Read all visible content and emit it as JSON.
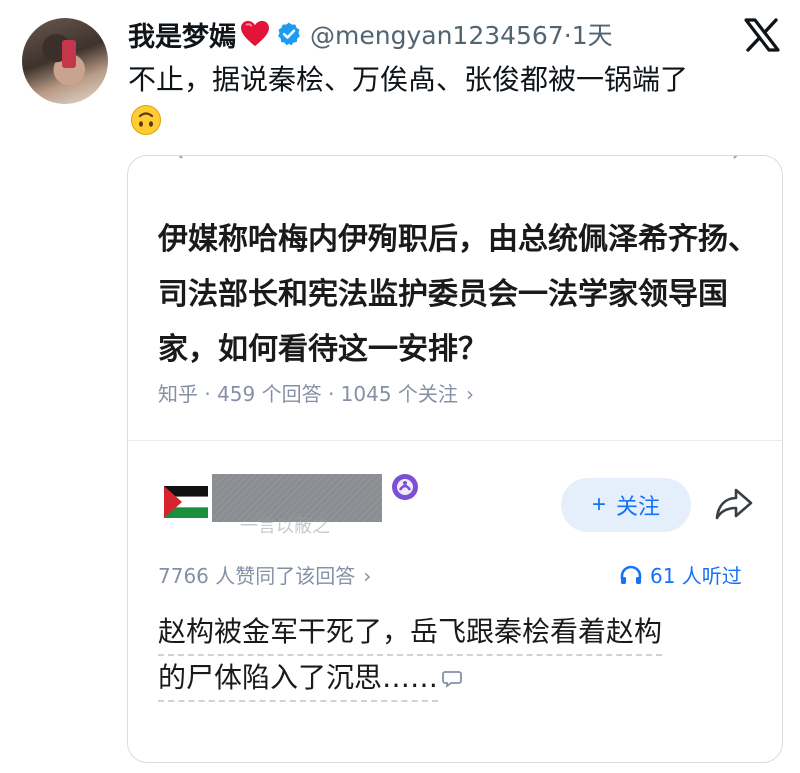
{
  "tweet": {
    "display_name": "我是梦嫣",
    "handle_time": "@mengyan1234567·1天",
    "text": "不止，据说秦桧、万俟卨、张俊都被一锅端了"
  },
  "icons": {
    "heart": "red-heart-icon",
    "verified": "verified-badge-icon",
    "platform": "x-logo-icon",
    "emoji": "upside-down-face-icon",
    "flag": "palestine-flag-icon",
    "share": "share-arrow-icon",
    "headphones": "headphones-icon",
    "comment": "comment-bubble-icon"
  },
  "colors": {
    "accent_blue": "#1772f6",
    "follow_bg": "#e5eefb",
    "meta_gray": "#8590a6",
    "x_verified": "#1d9bf0",
    "heart_red": "#e3143a"
  },
  "card": {
    "question_title": "伊媒称哈梅内伊殉职后，由总统佩泽希齐扬、司法部长和宪法监护委员会一法学家领导国家，如何看待这一安排？",
    "meta": "知乎 · 459 个回答 · 1045 个关注",
    "meta_chevron": "›",
    "author_signature": "一言以蔽之",
    "follow_label": "关注",
    "follow_plus": "+",
    "vote_text": "7766 人赞同了该回答",
    "vote_chevron": "›",
    "listen_text": "61 人听过",
    "answer_line1": "赵构被金军干死了，岳飞跟秦桧看着赵构",
    "answer_line2": "的尸体陷入了沉思……"
  }
}
